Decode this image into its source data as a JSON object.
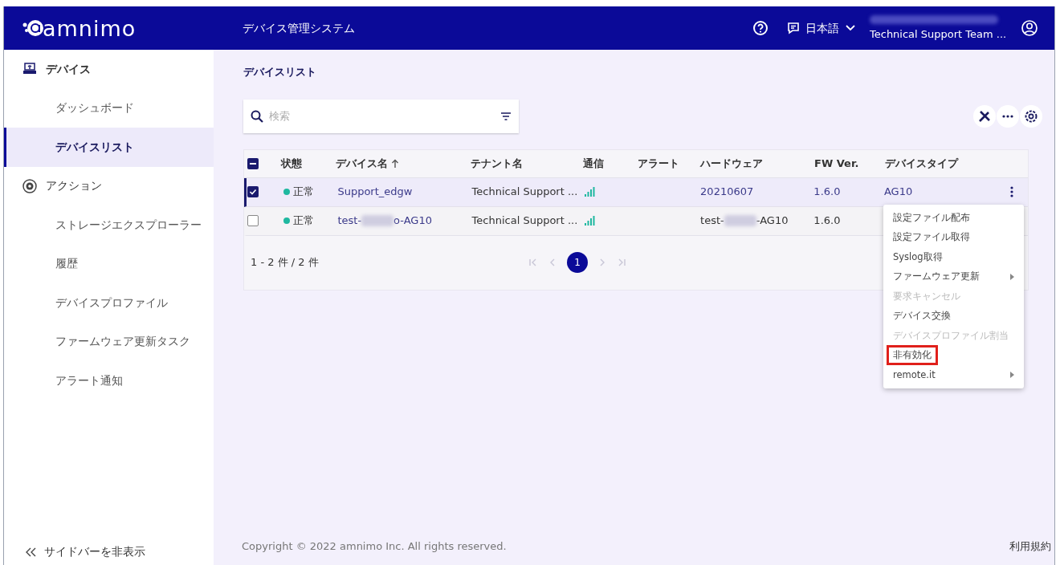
{
  "header": {
    "logo": "amnimo",
    "title": "デバイス管理システム",
    "language": "日本語",
    "account": "Technical Support Team ..."
  },
  "sidebar": {
    "items": [
      {
        "label": "デバイス",
        "kind": "section",
        "selected": false
      },
      {
        "label": "ダッシュボード",
        "kind": "link",
        "selected": false
      },
      {
        "label": "デバイスリスト",
        "kind": "link",
        "selected": true
      },
      {
        "label": "アクション",
        "kind": "section",
        "selected": false
      },
      {
        "label": "ストレージエクスプローラー",
        "kind": "link",
        "selected": false
      },
      {
        "label": "履歴",
        "kind": "link",
        "selected": false
      },
      {
        "label": "デバイスプロファイル",
        "kind": "link",
        "selected": false
      },
      {
        "label": "ファームウェア更新タスク",
        "kind": "link",
        "selected": false
      },
      {
        "label": "アラート通知",
        "kind": "link",
        "selected": false
      }
    ],
    "collapse": "サイドバーを非表示"
  },
  "breadcrumb": "デバイスリスト",
  "search": {
    "placeholder": "検索"
  },
  "table": {
    "select_all": {
      "indeterminate": true
    },
    "columns": [
      {
        "label": "状態"
      },
      {
        "label": "デバイス名",
        "sorted": true
      },
      {
        "label": "テナント名"
      },
      {
        "label": "通信"
      },
      {
        "label": "アラート"
      },
      {
        "label": "ハードウェア"
      },
      {
        "label": "FW Ver."
      },
      {
        "label": "デバイスタイプ"
      }
    ],
    "rows": [
      {
        "selected": true,
        "status": "正常",
        "color": "#1fb8a0",
        "name": [
          "Support_edgw"
        ],
        "tenant": "Technical Support ...",
        "signal": true,
        "hardware": [
          "20210607"
        ],
        "fw": "1.6.0",
        "type": "AG10"
      },
      {
        "selected": false,
        "status": "正常",
        "color": "#1fb8a0",
        "name": [
          "test-",
          "o-AG10"
        ],
        "tenant": "Technical Support ...",
        "signal": true,
        "hardware": [
          "test-",
          "-AG10"
        ],
        "fw": "1.6.0"
      }
    ],
    "count": "1 - 2 件 / 2 件",
    "pages": [
      {
        "label": "1",
        "selected": true
      }
    ]
  },
  "menu": {
    "items": [
      {
        "label": "設定ファイル配布",
        "disabled": false,
        "submenu": false,
        "highlighted": false
      },
      {
        "label": "設定ファイル取得",
        "disabled": false,
        "submenu": false,
        "highlighted": false
      },
      {
        "label": "Syslog取得",
        "disabled": false,
        "submenu": false,
        "highlighted": false
      },
      {
        "label": "ファームウェア更新",
        "disabled": false,
        "submenu": true,
        "highlighted": false
      },
      {
        "label": "要求キャンセル",
        "disabled": true,
        "submenu": false,
        "highlighted": false
      },
      {
        "label": "デバイス交換",
        "disabled": false,
        "submenu": false,
        "highlighted": false
      },
      {
        "label": "デバイスプロファイル割当",
        "disabled": true,
        "submenu": false,
        "highlighted": false
      },
      {
        "label": "非有効化",
        "disabled": false,
        "submenu": false,
        "highlighted": true
      },
      {
        "label": "remote.it",
        "disabled": false,
        "submenu": true,
        "highlighted": false
      }
    ]
  },
  "footer": {
    "copyright": "Copyright © 2022 amnimo Inc. All rights reserved.",
    "terms": "利用規約"
  }
}
